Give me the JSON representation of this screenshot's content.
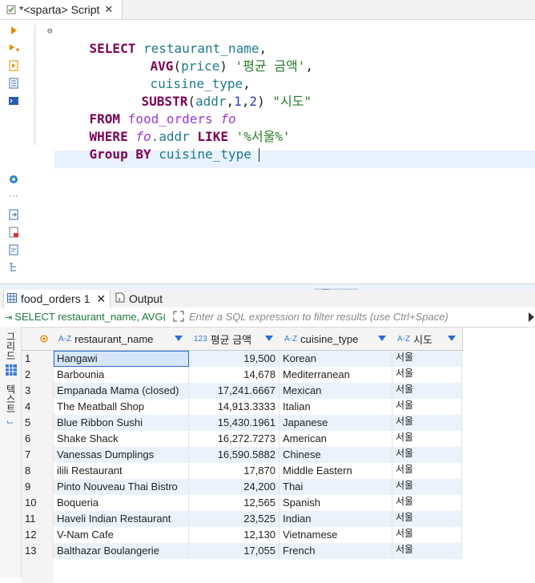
{
  "editor_tab": {
    "title": "*<sparta> Script"
  },
  "sql": {
    "l1_kw": "SELECT",
    "l1_id": "restaurant_name",
    "l1_p": ",",
    "l2_fn": "AVG",
    "l2_p1": "(",
    "l2_id": "price",
    "l2_p2": ")",
    "l2_str": "'평균 금액'",
    "l2_p3": ",",
    "l3_id": "cuisine_type",
    "l3_p": ",",
    "l4_fn": "SUBSTR",
    "l4_p1": "(",
    "l4_id": "addr",
    "l4_p2": ",",
    "l4_n1": "1",
    "l4_p3": ",",
    "l4_n2": "2",
    "l4_p4": ")",
    "l4_str": "\"시도\"",
    "l5_kw": "FROM",
    "l5_tbl": "food_orders",
    "l5_alias": "fo",
    "l6_kw": "WHERE",
    "l6_alias": "fo",
    "l6_id": ".addr",
    "l6_kw2": "LIKE",
    "l6_str": "'%서울%'",
    "l7_kw": "Group BY",
    "l7_id": "cuisine_type"
  },
  "results_tabs": [
    {
      "label": "food_orders 1"
    },
    {
      "label": "Output"
    }
  ],
  "filter": {
    "sql_preview": "SELECT restaurant_name, AVG(price)",
    "placeholder": "Enter a SQL expression to filter results (use Ctrl+Space)"
  },
  "sidebar": {
    "grid_label": "그리드",
    "text_label": "텍스트"
  },
  "columns": [
    {
      "type": "A-Z",
      "name": "restaurant_name"
    },
    {
      "type": "123",
      "name": "평균 금액"
    },
    {
      "type": "A-Z",
      "name": "cuisine_type"
    },
    {
      "type": "A-Z",
      "name": "시도"
    }
  ],
  "rows": [
    {
      "n": "1",
      "name": "Hangawi",
      "avg": "19,500",
      "cuisine": "Korean",
      "sido": "서울"
    },
    {
      "n": "2",
      "name": "Barbounia",
      "avg": "14,678",
      "cuisine": "Mediterranean",
      "sido": "서울"
    },
    {
      "n": "3",
      "name": "Empanada Mama (closed)",
      "avg": "17,241.6667",
      "cuisine": "Mexican",
      "sido": "서울"
    },
    {
      "n": "4",
      "name": "The Meatball Shop",
      "avg": "14,913.3333",
      "cuisine": "Italian",
      "sido": "서울"
    },
    {
      "n": "5",
      "name": "Blue Ribbon Sushi",
      "avg": "15,430.1961",
      "cuisine": "Japanese",
      "sido": "서울"
    },
    {
      "n": "6",
      "name": "Shake Shack",
      "avg": "16,272.7273",
      "cuisine": "American",
      "sido": "서울"
    },
    {
      "n": "7",
      "name": "Vanessas Dumplings",
      "avg": "16,590.5882",
      "cuisine": "Chinese",
      "sido": "서울"
    },
    {
      "n": "8",
      "name": "ilili Restaurant",
      "avg": "17,870",
      "cuisine": "Middle Eastern",
      "sido": "서울"
    },
    {
      "n": "9",
      "name": "Pinto Nouveau Thai Bistro",
      "avg": "24,200",
      "cuisine": "Thai",
      "sido": "서울"
    },
    {
      "n": "10",
      "name": "Boqueria",
      "avg": "12,565",
      "cuisine": "Spanish",
      "sido": "서울"
    },
    {
      "n": "11",
      "name": "Haveli Indian Restaurant",
      "avg": "23,525",
      "cuisine": "Indian",
      "sido": "서울"
    },
    {
      "n": "12",
      "name": "V-Nam Cafe",
      "avg": "12,130",
      "cuisine": "Vietnamese",
      "sido": "서울"
    },
    {
      "n": "13",
      "name": "Balthazar Boulangerie",
      "avg": "17,055",
      "cuisine": "French",
      "sido": "서울"
    }
  ]
}
